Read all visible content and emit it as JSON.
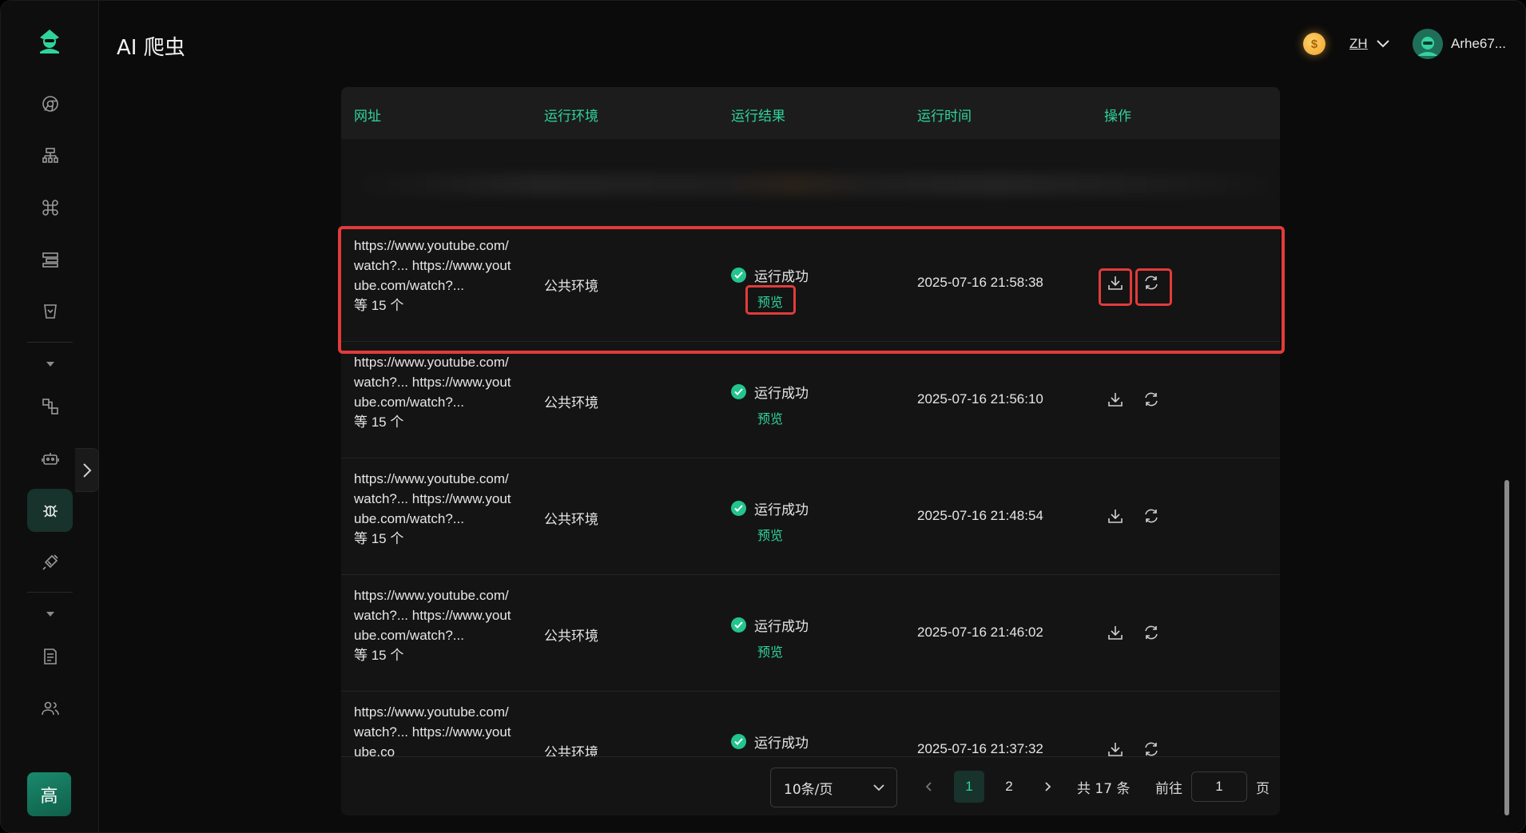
{
  "app": {
    "title": "AI 爬虫"
  },
  "header": {
    "lang": "ZH",
    "username": "Arhe67..."
  },
  "sidebar": {
    "plan_badge": "高",
    "items": [
      {
        "icon": "chrome-icon"
      },
      {
        "icon": "sitemap-icon"
      },
      {
        "icon": "command-icon"
      },
      {
        "icon": "layout-icon"
      },
      {
        "icon": "tag-icon"
      },
      {
        "icon": "flow-icon"
      },
      {
        "icon": "robot-icon"
      },
      {
        "icon": "bug-icon"
      },
      {
        "icon": "plugin-icon"
      },
      {
        "icon": "document-icon"
      },
      {
        "icon": "users-icon"
      }
    ]
  },
  "table": {
    "columns": [
      "网址",
      "运行环境",
      "运行结果",
      "运行时间",
      "操作"
    ],
    "rows": [
      {
        "url": "https://www.youtube.com/watch?... https://www.youtube.com/watch?...",
        "count": "等 15 个",
        "env": "公共环境",
        "status": "运行成功",
        "preview": "预览",
        "time": "2025-07-16 21:58:38"
      },
      {
        "url": "https://www.youtube.com/watch?... https://www.youtube.com/watch?...",
        "count": "等 15 个",
        "env": "公共环境",
        "status": "运行成功",
        "preview": "预览",
        "time": "2025-07-16 21:56:10"
      },
      {
        "url": "https://www.youtube.com/watch?... https://www.youtube.com/watch?...",
        "count": "等 15 个",
        "env": "公共环境",
        "status": "运行成功",
        "preview": "预览",
        "time": "2025-07-16 21:48:54"
      },
      {
        "url": "https://www.youtube.com/watch?... https://www.youtube.com/watch?...",
        "count": "等 15 个",
        "env": "公共环境",
        "status": "运行成功",
        "preview": "预览",
        "time": "2025-07-16 21:46:02"
      },
      {
        "url": "https://www.youtube.com/watch?... https://www.youtube.co",
        "count": "",
        "env": "公共环境",
        "status": "运行成功",
        "preview": "",
        "time": "2025-07-16 21:37:32"
      }
    ]
  },
  "pagination": {
    "page_size": "10条/页",
    "pages": [
      "1",
      "2"
    ],
    "current_page": "1",
    "total": "共 17 条",
    "goto_label": "前往",
    "goto_value": "1",
    "page_suffix": "页"
  },
  "colors": {
    "accent": "#2fd49b",
    "highlight": "#e23b3b",
    "success": "#23c48d"
  }
}
